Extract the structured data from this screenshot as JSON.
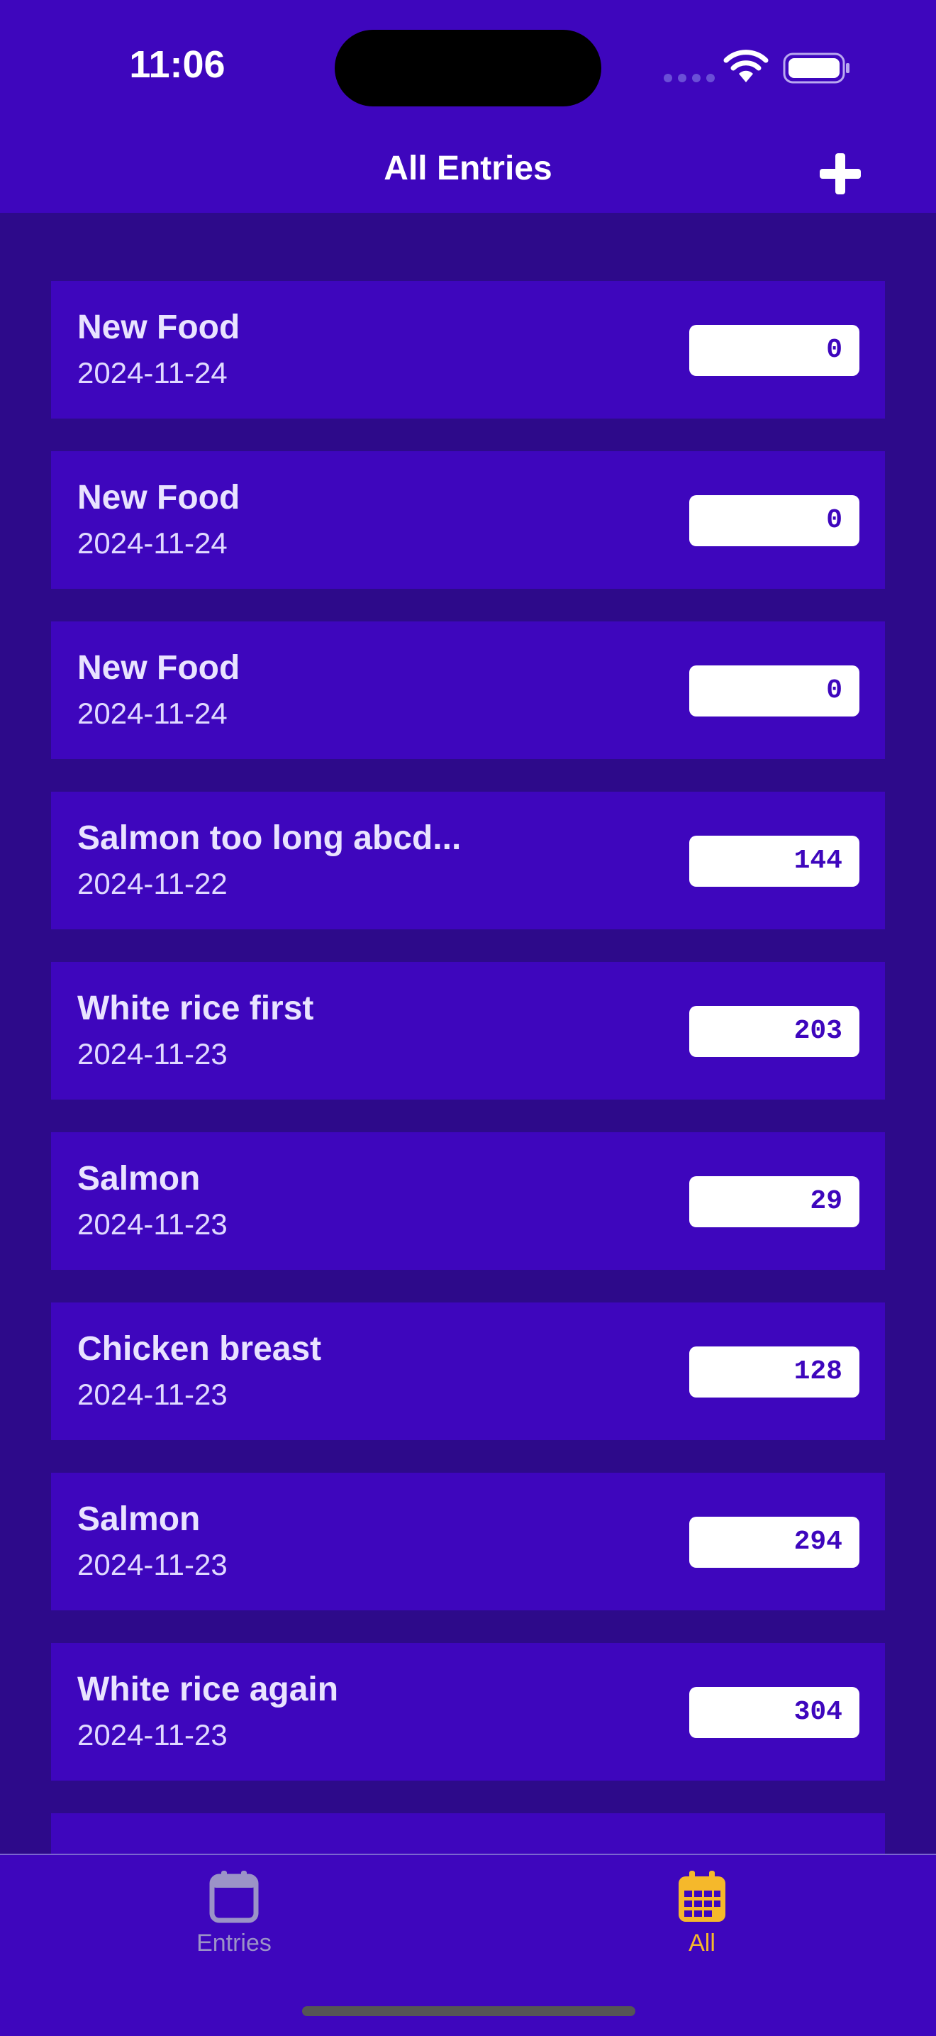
{
  "status_bar": {
    "time": "11:06"
  },
  "nav": {
    "title": "All Entries",
    "add_icon": "plus-icon"
  },
  "entries": [
    {
      "name": "New Food",
      "date": "2024-11-24",
      "value": "0"
    },
    {
      "name": "New Food",
      "date": "2024-11-24",
      "value": "0"
    },
    {
      "name": "New Food",
      "date": "2024-11-24",
      "value": "0"
    },
    {
      "name": "Salmon too long abcd...",
      "date": "2024-11-22",
      "value": "144"
    },
    {
      "name": "White rice first",
      "date": "2024-11-23",
      "value": "203"
    },
    {
      "name": "Salmon",
      "date": "2024-11-23",
      "value": "29"
    },
    {
      "name": "Chicken breast",
      "date": "2024-11-23",
      "value": "128"
    },
    {
      "name": "Salmon",
      "date": "2024-11-23",
      "value": "294"
    },
    {
      "name": "White rice again",
      "date": "2024-11-23",
      "value": "304"
    },
    {
      "name": "",
      "date": "",
      "value": ""
    }
  ],
  "tabs": [
    {
      "label": "Entries",
      "icon": "calendar-icon",
      "selected": false
    },
    {
      "label": "All",
      "icon": "calendar-grid-icon",
      "selected": true
    }
  ],
  "colors": {
    "background": "#2d0a8a",
    "primary": "#3e06bd",
    "accent": "#f5b82b",
    "inactive_tab": "#9b93c7"
  }
}
